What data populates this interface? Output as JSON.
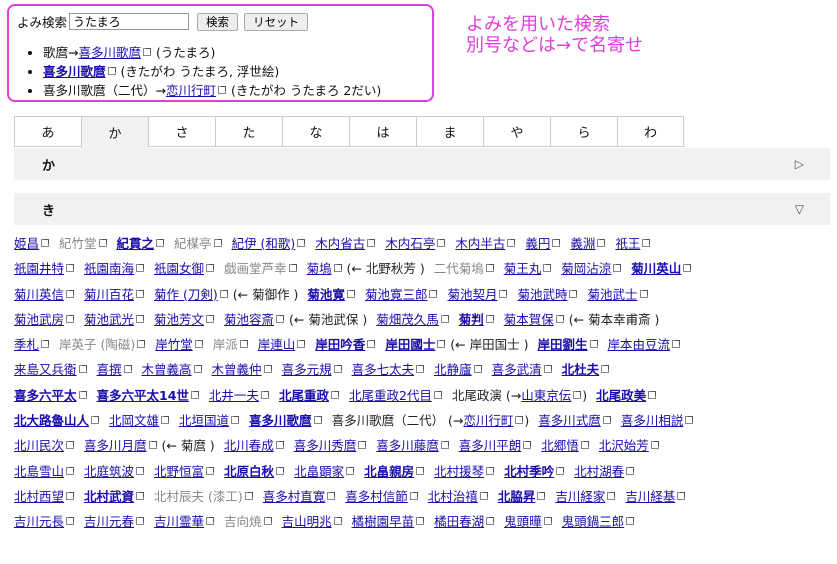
{
  "search": {
    "label": "よみ検索",
    "value": "うたまろ",
    "search_button": "検索",
    "reset_button": "リセット"
  },
  "results": [
    {
      "prefix": "歌麿→",
      "link": "喜多川歌麿",
      "bold": false,
      "suffix": " (うたまろ)"
    },
    {
      "prefix": "",
      "link": "喜多川歌麿",
      "bold": true,
      "suffix": " (きたがわ うたまろ, 浮世絵)"
    },
    {
      "prefix": "喜多川歌麿（二代）→",
      "link": "恋川行町",
      "bold": false,
      "suffix": " (きたがわ うたまろ 2だい)"
    }
  ],
  "annotation": {
    "line1": "よみを用いた検索",
    "line2": "別号などは→で名寄せ"
  },
  "tabs": [
    "あ",
    "か",
    "さ",
    "た",
    "な",
    "は",
    "ま",
    "や",
    "ら",
    "わ"
  ],
  "active_tab": 1,
  "sections": {
    "ka": {
      "title": "か",
      "arrow": "▷"
    },
    "ki": {
      "title": "き",
      "arrow": "▽"
    }
  },
  "entries": [
    [
      {
        "t": "姫昌",
        "s": "link"
      },
      {
        "t": "紀竹堂",
        "s": "dim"
      },
      {
        "t": "紀貫之",
        "s": "bold"
      },
      {
        "t": "紀楳亭",
        "s": "dim"
      },
      {
        "t": "紀伊 (和歌)",
        "s": "link"
      },
      {
        "t": "木内省古",
        "s": "link"
      },
      {
        "t": "木内石亭",
        "s": "link"
      },
      {
        "t": "木内半古",
        "s": "link"
      },
      {
        "t": "義円",
        "s": "link"
      },
      {
        "t": "義淵",
        "s": "link"
      },
      {
        "t": "祇王",
        "s": "link"
      }
    ],
    [
      {
        "t": "祇園井特",
        "s": "link"
      },
      {
        "t": "祇園南海",
        "s": "link"
      },
      {
        "t": "祇園女御",
        "s": "link"
      },
      {
        "t": "戯画堂芦幸",
        "s": "dim"
      },
      {
        "t": "菊塢",
        "s": "link",
        "x": " (← 北野秋芳 )"
      },
      {
        "t": "二代菊塢",
        "s": "dim"
      },
      {
        "t": "菊王丸",
        "s": "link"
      },
      {
        "t": "菊岡沾涼",
        "s": "link"
      },
      {
        "t": "菊川英山",
        "s": "bold"
      }
    ],
    [
      {
        "t": "菊川英信",
        "s": "link"
      },
      {
        "t": "菊川百花",
        "s": "link"
      },
      {
        "t": "菊作 (刀剣)",
        "s": "link",
        "x": " (← 菊御作 )"
      },
      {
        "t": "菊池寛",
        "s": "bold"
      },
      {
        "t": "菊池寛三郎",
        "s": "link"
      },
      {
        "t": "菊池契月",
        "s": "link"
      },
      {
        "t": "菊池武時",
        "s": "link"
      },
      {
        "t": "菊池武士",
        "s": "link"
      }
    ],
    [
      {
        "t": "菊池武房",
        "s": "link"
      },
      {
        "t": "菊池武光",
        "s": "link"
      },
      {
        "t": "菊池芳文",
        "s": "link"
      },
      {
        "t": "菊池容斎",
        "s": "link",
        "x": " (← 菊池武保 )"
      },
      {
        "t": "菊畑茂久馬",
        "s": "link"
      },
      {
        "t": "菊判",
        "s": "bold"
      },
      {
        "t": "菊本賀保",
        "s": "link",
        "x": " (← 菊本幸甫斎 )"
      }
    ],
    [
      {
        "t": "季札",
        "s": "link"
      },
      {
        "t": "岸英子 (陶磁)",
        "s": "dim"
      },
      {
        "t": "岸竹堂",
        "s": "link"
      },
      {
        "t": "岸派",
        "s": "dim"
      },
      {
        "t": "岸連山",
        "s": "link"
      },
      {
        "t": "岸田吟香",
        "s": "bold"
      },
      {
        "t": "岸田國士",
        "s": "bold",
        "x": " (← 岸田国士 )"
      },
      {
        "t": "岸田劉生",
        "s": "bold"
      },
      {
        "t": "岸本由豆流",
        "s": "link"
      }
    ],
    [
      {
        "t": "来島又兵衛",
        "s": "link"
      },
      {
        "t": "喜撰",
        "s": "link"
      },
      {
        "t": "木曾義高",
        "s": "link"
      },
      {
        "t": "木曾義仲",
        "s": "link"
      },
      {
        "t": "喜多元規",
        "s": "link"
      },
      {
        "t": "喜多七太夫",
        "s": "link"
      },
      {
        "t": "北静廬",
        "s": "link"
      },
      {
        "t": "喜多武清",
        "s": "link"
      },
      {
        "t": "北杜夫",
        "s": "bold"
      }
    ],
    [
      {
        "t": "喜多六平太",
        "s": "bold"
      },
      {
        "t": "喜多六平太14世",
        "s": "bold"
      },
      {
        "t": "北井一夫",
        "s": "link"
      },
      {
        "t": "北尾重政",
        "s": "bold"
      },
      {
        "t": "北尾重政2代目",
        "s": "link"
      },
      {
        "t": "北尾政演 (→",
        "s": "plain",
        "l": "山東京伝",
        "x": ")"
      },
      {
        "t": "北尾政美",
        "s": "bold"
      }
    ],
    [
      {
        "t": "北大路魯山人",
        "s": "bold"
      },
      {
        "t": "北岡文雄",
        "s": "link"
      },
      {
        "t": "北垣国道",
        "s": "link"
      },
      {
        "t": "喜多川歌麿",
        "s": "bold"
      },
      {
        "t": "喜多川歌麿（二代） (→",
        "s": "plain",
        "l": "恋川行町",
        "x": ")"
      },
      {
        "t": "喜多川式麿",
        "s": "link"
      },
      {
        "t": "喜多川相説",
        "s": "link"
      }
    ],
    [
      {
        "t": "北川民次",
        "s": "link"
      },
      {
        "t": "喜多川月麿",
        "s": "link",
        "x": " (← 菊麿 )"
      },
      {
        "t": "北川春成",
        "s": "link"
      },
      {
        "t": "喜多川秀麿",
        "s": "link"
      },
      {
        "t": "喜多川藤麿",
        "s": "link"
      },
      {
        "t": "喜多川平朗",
        "s": "link"
      },
      {
        "t": "北郷悟",
        "s": "link"
      },
      {
        "t": "北沢始芳",
        "s": "link"
      }
    ],
    [
      {
        "t": "北島雪山",
        "s": "link"
      },
      {
        "t": "北庭筑波",
        "s": "link"
      },
      {
        "t": "北野恒富",
        "s": "link"
      },
      {
        "t": "北原白秋",
        "s": "bold"
      },
      {
        "t": "北畠顕家",
        "s": "link"
      },
      {
        "t": "北畠親房",
        "s": "bold"
      },
      {
        "t": "北村援琴",
        "s": "link"
      },
      {
        "t": "北村季吟",
        "s": "bold"
      },
      {
        "t": "北村湖春",
        "s": "link"
      }
    ],
    [
      {
        "t": "北村西望",
        "s": "link"
      },
      {
        "t": "北村武資",
        "s": "bold"
      },
      {
        "t": "北村辰夫 (漆工)",
        "s": "dim"
      },
      {
        "t": "喜多村直寛",
        "s": "link"
      },
      {
        "t": "喜多村信節",
        "s": "link"
      },
      {
        "t": "北村治禧",
        "s": "link"
      },
      {
        "t": "北脇昇",
        "s": "bold"
      },
      {
        "t": "吉川経家",
        "s": "link"
      },
      {
        "t": "吉川経基",
        "s": "link"
      }
    ],
    [
      {
        "t": "吉川元長",
        "s": "link"
      },
      {
        "t": "吉川元春",
        "s": "link"
      },
      {
        "t": "吉川霊華",
        "s": "link"
      },
      {
        "t": "吉向焼",
        "s": "dim"
      },
      {
        "t": "吉山明兆",
        "s": "link"
      },
      {
        "t": "橘樹園早苗",
        "s": "link"
      },
      {
        "t": "橘田春湖",
        "s": "link"
      },
      {
        "t": "鬼頭曄",
        "s": "link"
      },
      {
        "t": "鬼頭鍋三郎",
        "s": "link"
      }
    ]
  ]
}
